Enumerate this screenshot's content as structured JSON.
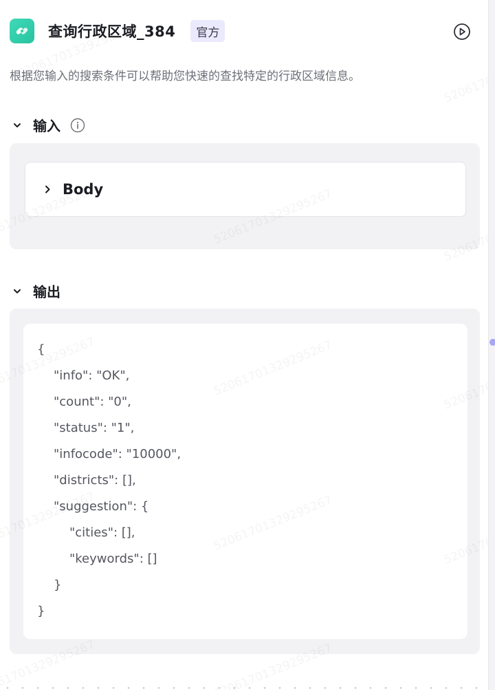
{
  "header": {
    "title": "查询行政区域_384",
    "badge": "官方"
  },
  "description": "根据您输入的搜索条件可以帮助您快速的查找特定的行政区域信息。",
  "input_section": {
    "title": "输入",
    "body_label": "Body"
  },
  "output_section": {
    "title": "输出",
    "json_lines": [
      "{",
      "\"info\": \"OK\",",
      "\"count\": \"0\",",
      "\"status\": \"1\",",
      "\"infocode\": \"10000\",",
      "\"districts\": [],",
      "\"suggestion\": {",
      "\"cities\": [],",
      "\"keywords\": []",
      "}",
      "}"
    ]
  },
  "watermark": "5206170132929526​7",
  "colors": {
    "accent_icon": "#2fcfab",
    "badge_bg": "#ebe9fd",
    "panel_bg": "#f2f2f4"
  }
}
